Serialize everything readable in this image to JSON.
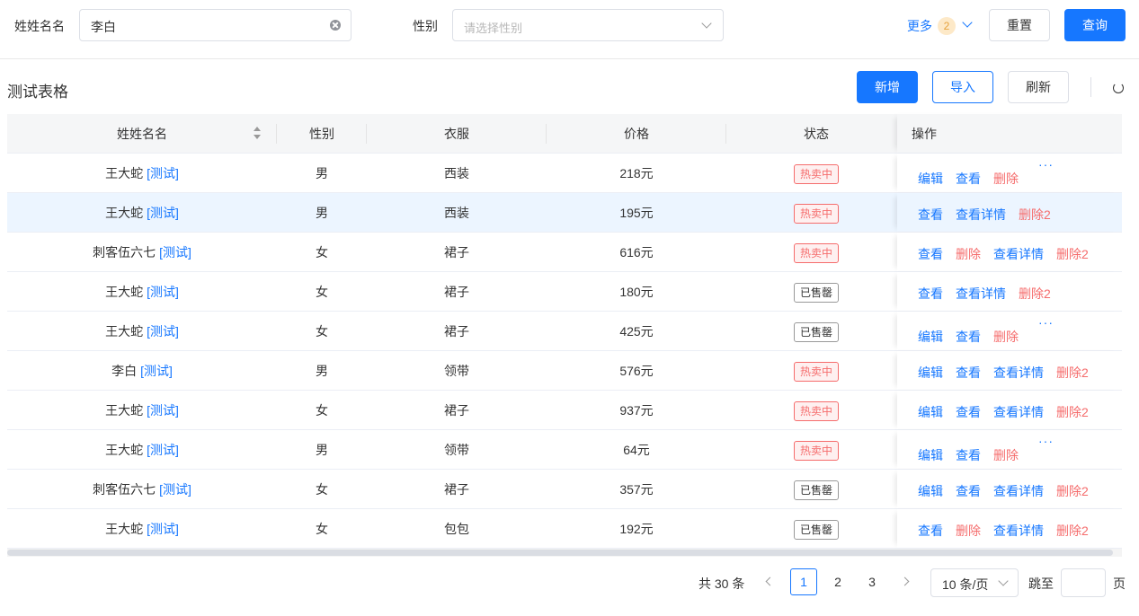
{
  "search": {
    "name_label": "姓姓名名",
    "name_value": "李白",
    "gender_label": "性别",
    "gender_placeholder": "请选择性别",
    "more_label": "更多",
    "more_count": "2",
    "reset_label": "重置",
    "query_label": "查询"
  },
  "toolbar": {
    "title": "测试表格",
    "add_label": "新增",
    "import_label": "导入",
    "refresh_label": "刷新"
  },
  "table": {
    "columns": [
      "姓姓名名",
      "性别",
      "衣服",
      "价格",
      "状态",
      "操作"
    ],
    "rows": [
      {
        "name": "王大蛇",
        "tag": "[测试]",
        "gender": "男",
        "clothes": "西装",
        "price": "218元",
        "status": "热卖中",
        "ops": [
          "编辑",
          "查看",
          "删除"
        ],
        "more": "···"
      },
      {
        "name": "王大蛇",
        "tag": "[测试]",
        "gender": "男",
        "clothes": "西装",
        "price": "195元",
        "status": "热卖中",
        "ops": [
          "查看",
          "查看详情",
          "删除2"
        ],
        "more": ""
      },
      {
        "name": "刺客伍六七",
        "tag": "[测试]",
        "gender": "女",
        "clothes": "裙子",
        "price": "616元",
        "status": "热卖中",
        "ops": [
          "查看",
          "删除",
          "查看详情",
          "删除2"
        ],
        "more": ""
      },
      {
        "name": "王大蛇",
        "tag": "[测试]",
        "gender": "女",
        "clothes": "裙子",
        "price": "180元",
        "status": "已售罄",
        "ops": [
          "查看",
          "查看详情",
          "删除2"
        ],
        "more": ""
      },
      {
        "name": "王大蛇",
        "tag": "[测试]",
        "gender": "女",
        "clothes": "裙子",
        "price": "425元",
        "status": "已售罄",
        "ops": [
          "编辑",
          "查看",
          "删除"
        ],
        "more": "···"
      },
      {
        "name": "李白",
        "tag": "[测试]",
        "gender": "男",
        "clothes": "领带",
        "price": "576元",
        "status": "热卖中",
        "ops": [
          "编辑",
          "查看",
          "查看详情",
          "删除2"
        ],
        "more": ""
      },
      {
        "name": "王大蛇",
        "tag": "[测试]",
        "gender": "女",
        "clothes": "裙子",
        "price": "937元",
        "status": "热卖中",
        "ops": [
          "编辑",
          "查看",
          "查看详情",
          "删除2"
        ],
        "more": ""
      },
      {
        "name": "王大蛇",
        "tag": "[测试]",
        "gender": "男",
        "clothes": "领带",
        "price": "64元",
        "status": "热卖中",
        "ops": [
          "编辑",
          "查看",
          "删除"
        ],
        "more": "···"
      },
      {
        "name": "刺客伍六七",
        "tag": "[测试]",
        "gender": "女",
        "clothes": "裙子",
        "price": "357元",
        "status": "已售罄",
        "ops": [
          "编辑",
          "查看",
          "查看详情",
          "删除2"
        ],
        "more": ""
      },
      {
        "name": "王大蛇",
        "tag": "[测试]",
        "gender": "女",
        "clothes": "包包",
        "price": "192元",
        "status": "已售罄",
        "ops": [
          "查看",
          "删除",
          "查看详情",
          "删除2"
        ],
        "more": ""
      }
    ]
  },
  "pagination": {
    "total": "共 30 条",
    "pages": [
      "1",
      "2",
      "3"
    ],
    "current": "1",
    "page_size": "10 条/页",
    "jump_label": "跳至",
    "page_suffix": "页"
  },
  "colors": {
    "primary": "#1677ff",
    "danger": "#f56c6c",
    "highlight_row": "#ecf5ff"
  }
}
